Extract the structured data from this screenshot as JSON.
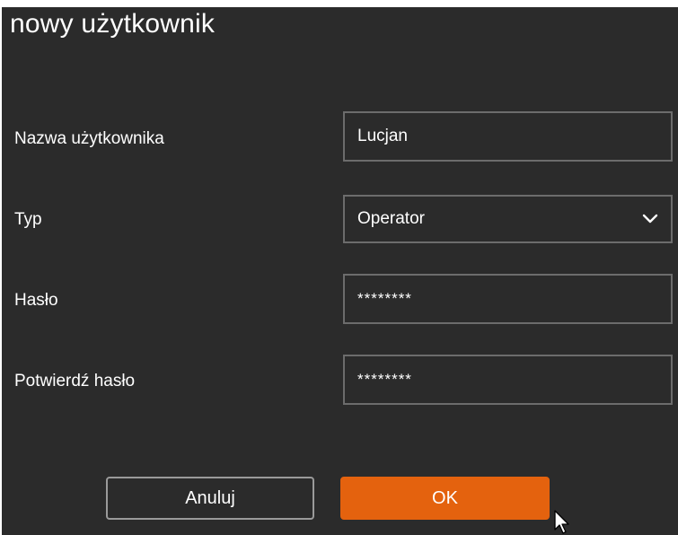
{
  "dialog": {
    "title": "nowy użytkownik"
  },
  "form": {
    "username_label": "Nazwa użytkownika",
    "username_value": "Lucjan",
    "type_label": "Typ",
    "type_value": "Operator",
    "password_label": "Hasło",
    "password_value": "********",
    "confirm_label": "Potwierdź hasło",
    "confirm_value": "********"
  },
  "buttons": {
    "cancel_label": "Anuluj",
    "ok_label": "OK"
  },
  "colors": {
    "background": "#2b2b2b",
    "accent": "#e4620e",
    "border": "#6c6c6c"
  },
  "icons": {
    "dropdown": "chevron-down-icon",
    "cursor": "mouse-pointer-icon"
  }
}
